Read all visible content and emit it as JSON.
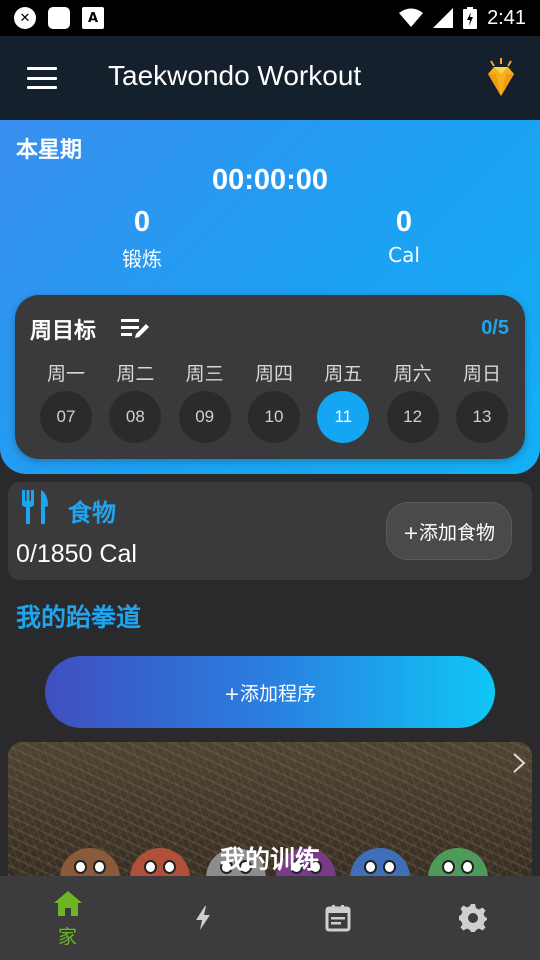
{
  "status_bar": {
    "time": "2:41"
  },
  "app_bar": {
    "title": "Taekwondo Workout"
  },
  "hero": {
    "week_label": "本星期",
    "timer": "00:00:00",
    "workout_count": "0",
    "workout_label": "锻炼",
    "cal_count": "0",
    "cal_label": "Cal"
  },
  "weekly_goal": {
    "title": "周目标",
    "progress": "0/5",
    "days": [
      {
        "name": "周一",
        "date": "07"
      },
      {
        "name": "周二",
        "date": "08"
      },
      {
        "name": "周三",
        "date": "09"
      },
      {
        "name": "周四",
        "date": "10"
      },
      {
        "name": "周五",
        "date": "11"
      },
      {
        "name": "周六",
        "date": "12"
      },
      {
        "name": "周日",
        "date": "13"
      }
    ],
    "active_day": "11"
  },
  "food": {
    "title": "食物",
    "calories": "0/1850 Cal",
    "add_label": "+添加食物"
  },
  "section_title": "我的跆拳道",
  "add_program_label": "+添加程序",
  "training_card": {
    "title": "我的训练"
  },
  "bottom_nav": {
    "home_label": "家"
  },
  "colors": {
    "accent": "#1ea5f0",
    "nav_active": "#6db523",
    "app_bar": "#14202b"
  }
}
